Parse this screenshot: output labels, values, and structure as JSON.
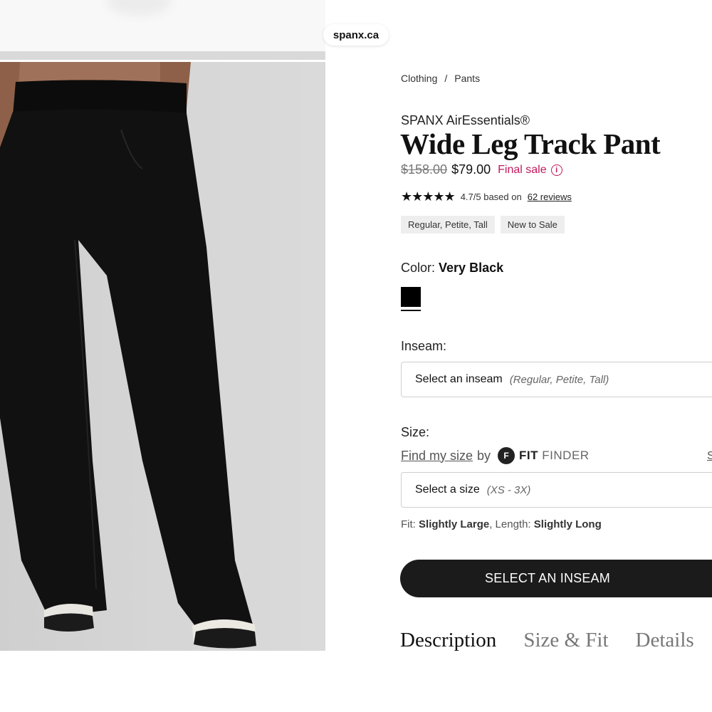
{
  "browser": {
    "url": "spanx.ca"
  },
  "breadcrumb": {
    "items": [
      "Clothing",
      "Pants"
    ],
    "separator": "/"
  },
  "product": {
    "brand": "SPANX AirEssentials®",
    "title": "Wide Leg Track Pant",
    "original_price": "$158.00",
    "sale_price": "$79.00",
    "sale_label": "Final sale",
    "info_glyph": "i",
    "rating_stars": "★★★★★",
    "rating_value": 4.7,
    "rating_text": "4.7/5 based on",
    "reviews_link": "62 reviews",
    "tags": [
      "Regular, Petite, Tall",
      "New to Sale"
    ]
  },
  "color": {
    "label": "Color:",
    "value": "Very Black",
    "swatch_hex": "#000000"
  },
  "inseam": {
    "label": "Inseam:",
    "placeholder": "Select an inseam",
    "hint": "(Regular, Petite, Tall)"
  },
  "size": {
    "label": "Size:",
    "find_link": "Find my size",
    "by": "by",
    "fitfinder_bold": "FIT",
    "fitfinder_light": "FINDER",
    "size_guide_partial": "S",
    "placeholder": "Select a size",
    "hint": "(XS - 3X)"
  },
  "fit": {
    "fit_label": "Fit:",
    "fit_value": "Slightly Large",
    "length_label": "Length:",
    "length_value": "Slightly Long"
  },
  "cta": {
    "label": "SELECT AN INSEAM"
  },
  "tabs": [
    "Description",
    "Size & Fit",
    "Details"
  ],
  "colors": {
    "accent_sale": "#c2185b",
    "button_bg": "#1b1b1b"
  }
}
